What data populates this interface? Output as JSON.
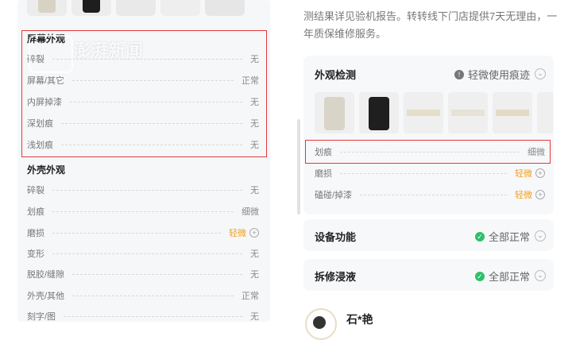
{
  "left_panel": {
    "screen_section_title": "屏幕外观",
    "screen_rows": [
      {
        "label": "碎裂",
        "value": "无",
        "warn": false
      },
      {
        "label": "屏幕/其它",
        "value": "正常",
        "warn": false
      },
      {
        "label": "内屏掉漆",
        "value": "无",
        "warn": false
      },
      {
        "label": "深划痕",
        "value": "无",
        "warn": false
      },
      {
        "label": "浅划痕",
        "value": "无",
        "warn": false
      }
    ],
    "shell_section_title": "外壳外观",
    "shell_rows": [
      {
        "label": "碎裂",
        "value": "无",
        "warn": false
      },
      {
        "label": "划痕",
        "value": "细微",
        "warn": false
      },
      {
        "label": "磨损",
        "value": "轻微",
        "warn": true
      },
      {
        "label": "变形",
        "value": "无",
        "warn": false
      },
      {
        "label": "脱胶/缝隙",
        "value": "无",
        "warn": false
      },
      {
        "label": "外壳/其他",
        "value": "正常",
        "warn": false
      },
      {
        "label": "刻字/图",
        "value": "无",
        "warn": false
      }
    ],
    "watermark": "澎湃新闻"
  },
  "right_panel": {
    "intro_text": "测结果详见验机报告。转转线下门店提供7天无理由，一年质保维修服务。",
    "appearance": {
      "title": "外观检测",
      "status": "轻微使用痕迹",
      "rows": [
        {
          "label": "划痕",
          "value": "细微",
          "warn": false
        },
        {
          "label": "磨损",
          "value": "轻微",
          "warn": true
        },
        {
          "label": "磕碰/掉漆",
          "value": "轻微",
          "warn": true
        }
      ]
    },
    "function": {
      "title": "设备功能",
      "status": "全部正常"
    },
    "repair": {
      "title": "拆修浸液",
      "status": "全部正常"
    },
    "user": {
      "name": "石*艳"
    }
  },
  "colors": {
    "accent_red": "#e23a3a",
    "warn_orange": "#f0a020",
    "ok_green": "#2fbf6a"
  }
}
